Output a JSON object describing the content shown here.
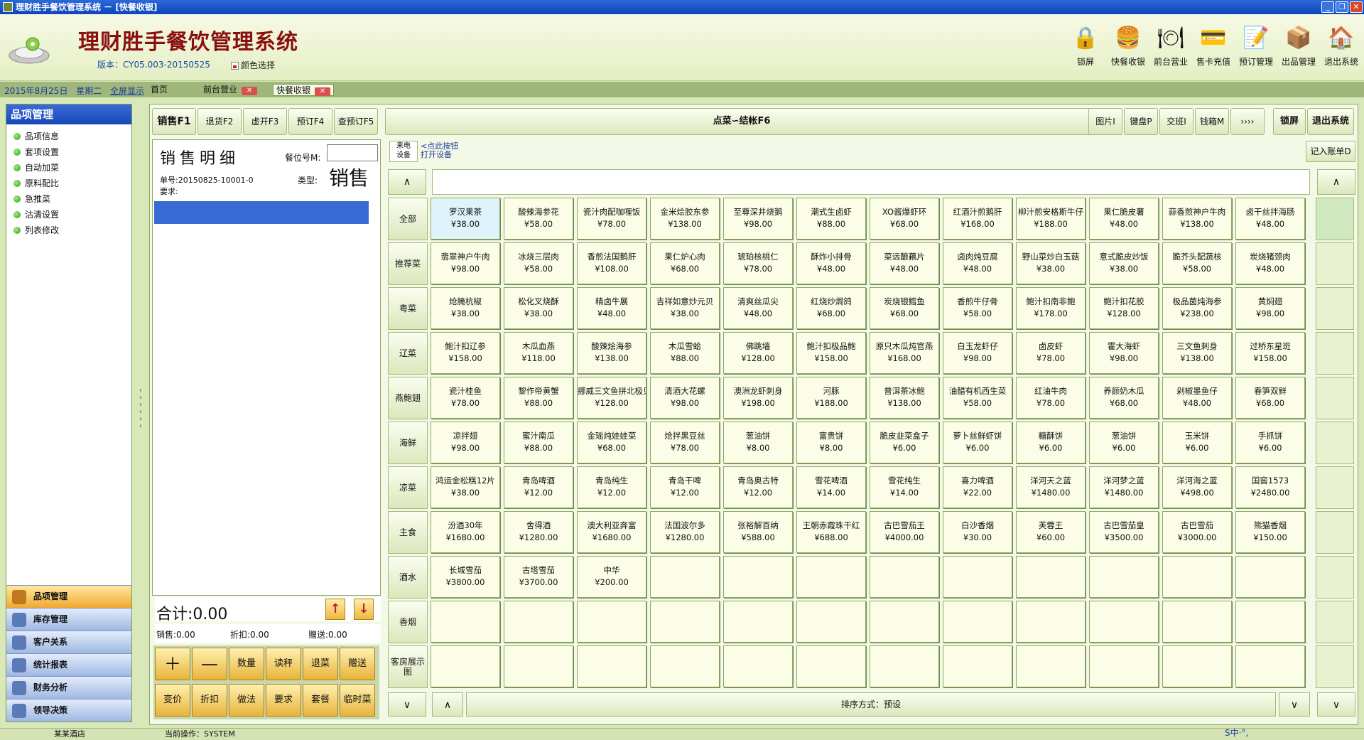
{
  "window": {
    "title": "理财胜手餐饮管理系统 － [快餐收银]"
  },
  "header": {
    "app_title": "理财胜手餐饮管理系统",
    "version": "版本：CY05.003-20150525",
    "color_select": "颜色选择",
    "tools": [
      {
        "label": "锁屏",
        "icon": "lock-icon",
        "glyph": "🔒"
      },
      {
        "label": "快餐收银",
        "icon": "burger-icon",
        "glyph": "🍔"
      },
      {
        "label": "前台营业",
        "icon": "waiter-icon",
        "glyph": "🍽"
      },
      {
        "label": "售卡充值",
        "icon": "card-icon",
        "glyph": "💳"
      },
      {
        "label": "预订管理",
        "icon": "booking-icon",
        "glyph": "📝"
      },
      {
        "label": "出品管理",
        "icon": "box-icon",
        "glyph": "📦"
      },
      {
        "label": "退出系统",
        "icon": "home-icon",
        "glyph": "🏠"
      }
    ]
  },
  "tabbar": {
    "date": "2015年8月25日",
    "weekday": "星期二",
    "fullscreen": "全屏显示",
    "tabs": [
      "首页",
      "前台营业",
      "快餐收银"
    ]
  },
  "sidebar": {
    "title": "品项管理",
    "items": [
      "品项信息",
      "套项设置",
      "自动加菜",
      "原料配比",
      "急推菜",
      "沽清设置",
      "列表修改"
    ],
    "modules": [
      "品项管理",
      "库存管理",
      "客户关系",
      "统计报表",
      "财务分析",
      "领导决策"
    ]
  },
  "topbar": {
    "sale": "销售F1",
    "returns": "退货F2",
    "virtual": "虚开F3",
    "reserve": "预订F4",
    "query": "查预订F5",
    "checkout": "点菜∽结帐F6",
    "picture": "图片I",
    "keyboard": "键盘P",
    "shift": "交班I",
    "cashbox": "钱箱M",
    "more": "››››",
    "lock": "锁屏",
    "exit": "退出系统"
  },
  "sale": {
    "title": "销售明细",
    "seat_label": "餐位号M:",
    "seat_value": "",
    "order_no": "单号:20150825-10001-0",
    "request": "要求:",
    "type_label": "类型:",
    "type_value": "销售",
    "total": "合计:0.00",
    "sales": "销售:0.00",
    "discount": "折扣:0.00",
    "gift": "赠送:0.00"
  },
  "keypad": {
    "row1": [
      "＋",
      "—",
      "数量",
      "读秤",
      "退菜",
      "赠送"
    ],
    "row2": [
      "变价",
      "折扣",
      "做法",
      "要求",
      "套餐",
      "临时菜"
    ]
  },
  "device": {
    "label": "来电\n设备",
    "link1": "<点此按钮",
    "link2": "打开设备"
  },
  "record_button": "记入账单D",
  "categories": [
    "全部",
    "推荐菜",
    "粤菜",
    "辽菜",
    "燕鲍翅",
    "海鲜",
    "凉菜",
    "主食",
    "酒水",
    "香烟",
    "客房展示图"
  ],
  "dishes": [
    [
      [
        "罗汉果茶",
        "¥38.00"
      ],
      [
        "酸辣海参花",
        "¥58.00"
      ],
      [
        "瓷汁肉配咖喱饭",
        "¥78.00"
      ],
      [
        "金米烩胶东参",
        "¥138.00"
      ],
      [
        "至尊深井烧鹅",
        "¥98.00"
      ],
      [
        "潮式生卤虾",
        "¥88.00"
      ],
      [
        "XO酱爆虾环",
        "¥68.00"
      ],
      [
        "红酒汁煎鹅肝",
        "¥168.00"
      ],
      [
        "柳汁煎安格斯牛仔",
        "¥188.00"
      ],
      [
        "果仁脆皮薯",
        "¥48.00"
      ],
      [
        "蒜香煎神户牛肉",
        "¥138.00"
      ],
      [
        "卤干丝拌海肠",
        "¥48.00"
      ]
    ],
    [
      [
        "翡翠神户牛肉",
        "¥98.00"
      ],
      [
        "冰烧三层肉",
        "¥58.00"
      ],
      [
        "香煎法国鹅肝",
        "¥108.00"
      ],
      [
        "果仁炉心肉",
        "¥68.00"
      ],
      [
        "琥珀核桃仁",
        "¥78.00"
      ],
      [
        "酥炸小排骨",
        "¥48.00"
      ],
      [
        "菜远酿藕片",
        "¥48.00"
      ],
      [
        "卤肉炖豆腐",
        "¥48.00"
      ],
      [
        "野山菜炒白玉菇",
        "¥38.00"
      ],
      [
        "意式脆皮炒饭",
        "¥38.00"
      ],
      [
        "脆芥头配蔬核",
        "¥58.00"
      ],
      [
        "炭烧猪颈肉",
        "¥48.00"
      ]
    ],
    [
      [
        "炝腌杭椒",
        "¥38.00"
      ],
      [
        "松化叉烧酥",
        "¥38.00"
      ],
      [
        "精卤牛展",
        "¥48.00"
      ],
      [
        "吉祥如意炒元贝",
        "¥38.00"
      ],
      [
        "清爽丝瓜尖",
        "¥48.00"
      ],
      [
        "红烧炒焗鸽",
        "¥68.00"
      ],
      [
        "炭烧银鳕鱼",
        "¥68.00"
      ],
      [
        "香煎牛仔骨",
        "¥58.00"
      ],
      [
        "鲍汁扣南非鲍",
        "¥178.00"
      ],
      [
        "鲍汁扣花胶",
        "¥128.00"
      ],
      [
        "极品菌炖海参",
        "¥238.00"
      ],
      [
        "黄焖翅",
        "¥98.00"
      ]
    ],
    [
      [
        "鲍汁扣辽参",
        "¥158.00"
      ],
      [
        "木瓜血燕",
        "¥118.00"
      ],
      [
        "酸辣烩海参",
        "¥138.00"
      ],
      [
        "木瓜雪蛤",
        "¥88.00"
      ],
      [
        "佛跳墙",
        "¥128.00"
      ],
      [
        "鲍汁扣极品鲍",
        "¥158.00"
      ],
      [
        "原只木瓜炖官燕",
        "¥168.00"
      ],
      [
        "白玉龙虾仔",
        "¥98.00"
      ],
      [
        "卤皮虾",
        "¥78.00"
      ],
      [
        "霍大海虾",
        "¥98.00"
      ],
      [
        "三文鱼刺身",
        "¥138.00"
      ],
      [
        "过桥东星斑",
        "¥158.00"
      ]
    ],
    [
      [
        "瓷汁桂鱼",
        "¥78.00"
      ],
      [
        "黎作帝黄蟹",
        "¥88.00"
      ],
      [
        "挪威三文鱼拼北极贝",
        "¥128.00"
      ],
      [
        "清酒大花螺",
        "¥98.00"
      ],
      [
        "澳洲龙虾刺身",
        "¥198.00"
      ],
      [
        "河豚",
        "¥188.00"
      ],
      [
        "普洱茶冰鲍",
        "¥138.00"
      ],
      [
        "油醋有机西生菜",
        "¥58.00"
      ],
      [
        "红油牛肉",
        "¥78.00"
      ],
      [
        "养颜奶木瓜",
        "¥68.00"
      ],
      [
        "剁椒墨鱼仔",
        "¥48.00"
      ],
      [
        "春笋双鲜",
        "¥68.00"
      ]
    ],
    [
      [
        "凉拌翅",
        "¥98.00"
      ],
      [
        "蜜汁南瓜",
        "¥88.00"
      ],
      [
        "金瑶炖娃娃菜",
        "¥68.00"
      ],
      [
        "炝拌黑豆丝",
        "¥78.00"
      ],
      [
        "葱油饼",
        "¥8.00"
      ],
      [
        "富贵饼",
        "¥8.00"
      ],
      [
        "脆皮韭菜盒子",
        "¥6.00"
      ],
      [
        "萝卜丝鲜虾饼",
        "¥6.00"
      ],
      [
        "糖酥饼",
        "¥6.00"
      ],
      [
        "葱油饼",
        "¥6.00"
      ],
      [
        "玉米饼",
        "¥6.00"
      ],
      [
        "手抓饼",
        "¥6.00"
      ]
    ],
    [
      [
        "鸿运金松糕12片",
        "¥38.00"
      ],
      [
        "青岛啤酒",
        "¥12.00"
      ],
      [
        "青岛纯生",
        "¥12.00"
      ],
      [
        "青岛干啤",
        "¥12.00"
      ],
      [
        "青岛奥古特",
        "¥12.00"
      ],
      [
        "雪花啤酒",
        "¥14.00"
      ],
      [
        "雪花纯生",
        "¥14.00"
      ],
      [
        "喜力啤酒",
        "¥22.00"
      ],
      [
        "洋河天之蓝",
        "¥1480.00"
      ],
      [
        "洋河梦之蓝",
        "¥1480.00"
      ],
      [
        "洋河海之蓝",
        "¥498.00"
      ],
      [
        "国窖1573",
        "¥2480.00"
      ]
    ],
    [
      [
        "汾酒30年",
        "¥1680.00"
      ],
      [
        "舍得酒",
        "¥1280.00"
      ],
      [
        "澳大利亚奔富",
        "¥1680.00"
      ],
      [
        "法国波尔多",
        "¥1280.00"
      ],
      [
        "张裕解百纳",
        "¥588.00"
      ],
      [
        "王朝赤霞珠干红",
        "¥688.00"
      ],
      [
        "古巴雪茄王",
        "¥4000.00"
      ],
      [
        "白沙香烟",
        "¥30.00"
      ],
      [
        "芙蓉王",
        "¥60.00"
      ],
      [
        "古巴雪茄皇",
        "¥3500.00"
      ],
      [
        "古巴雪茄",
        "¥3000.00"
      ],
      [
        "熊猫香烟",
        "¥150.00"
      ]
    ],
    [
      [
        "长城雪茄",
        "¥3800.00"
      ],
      [
        "古塔雪茄",
        "¥3700.00"
      ],
      [
        "中华",
        "¥200.00"
      ]
    ]
  ],
  "sort_label": "排序方式：预设",
  "status": {
    "hotel": "某某酒店",
    "operator": "当前操作：SYSTEM",
    "ime": "S中·°,"
  }
}
